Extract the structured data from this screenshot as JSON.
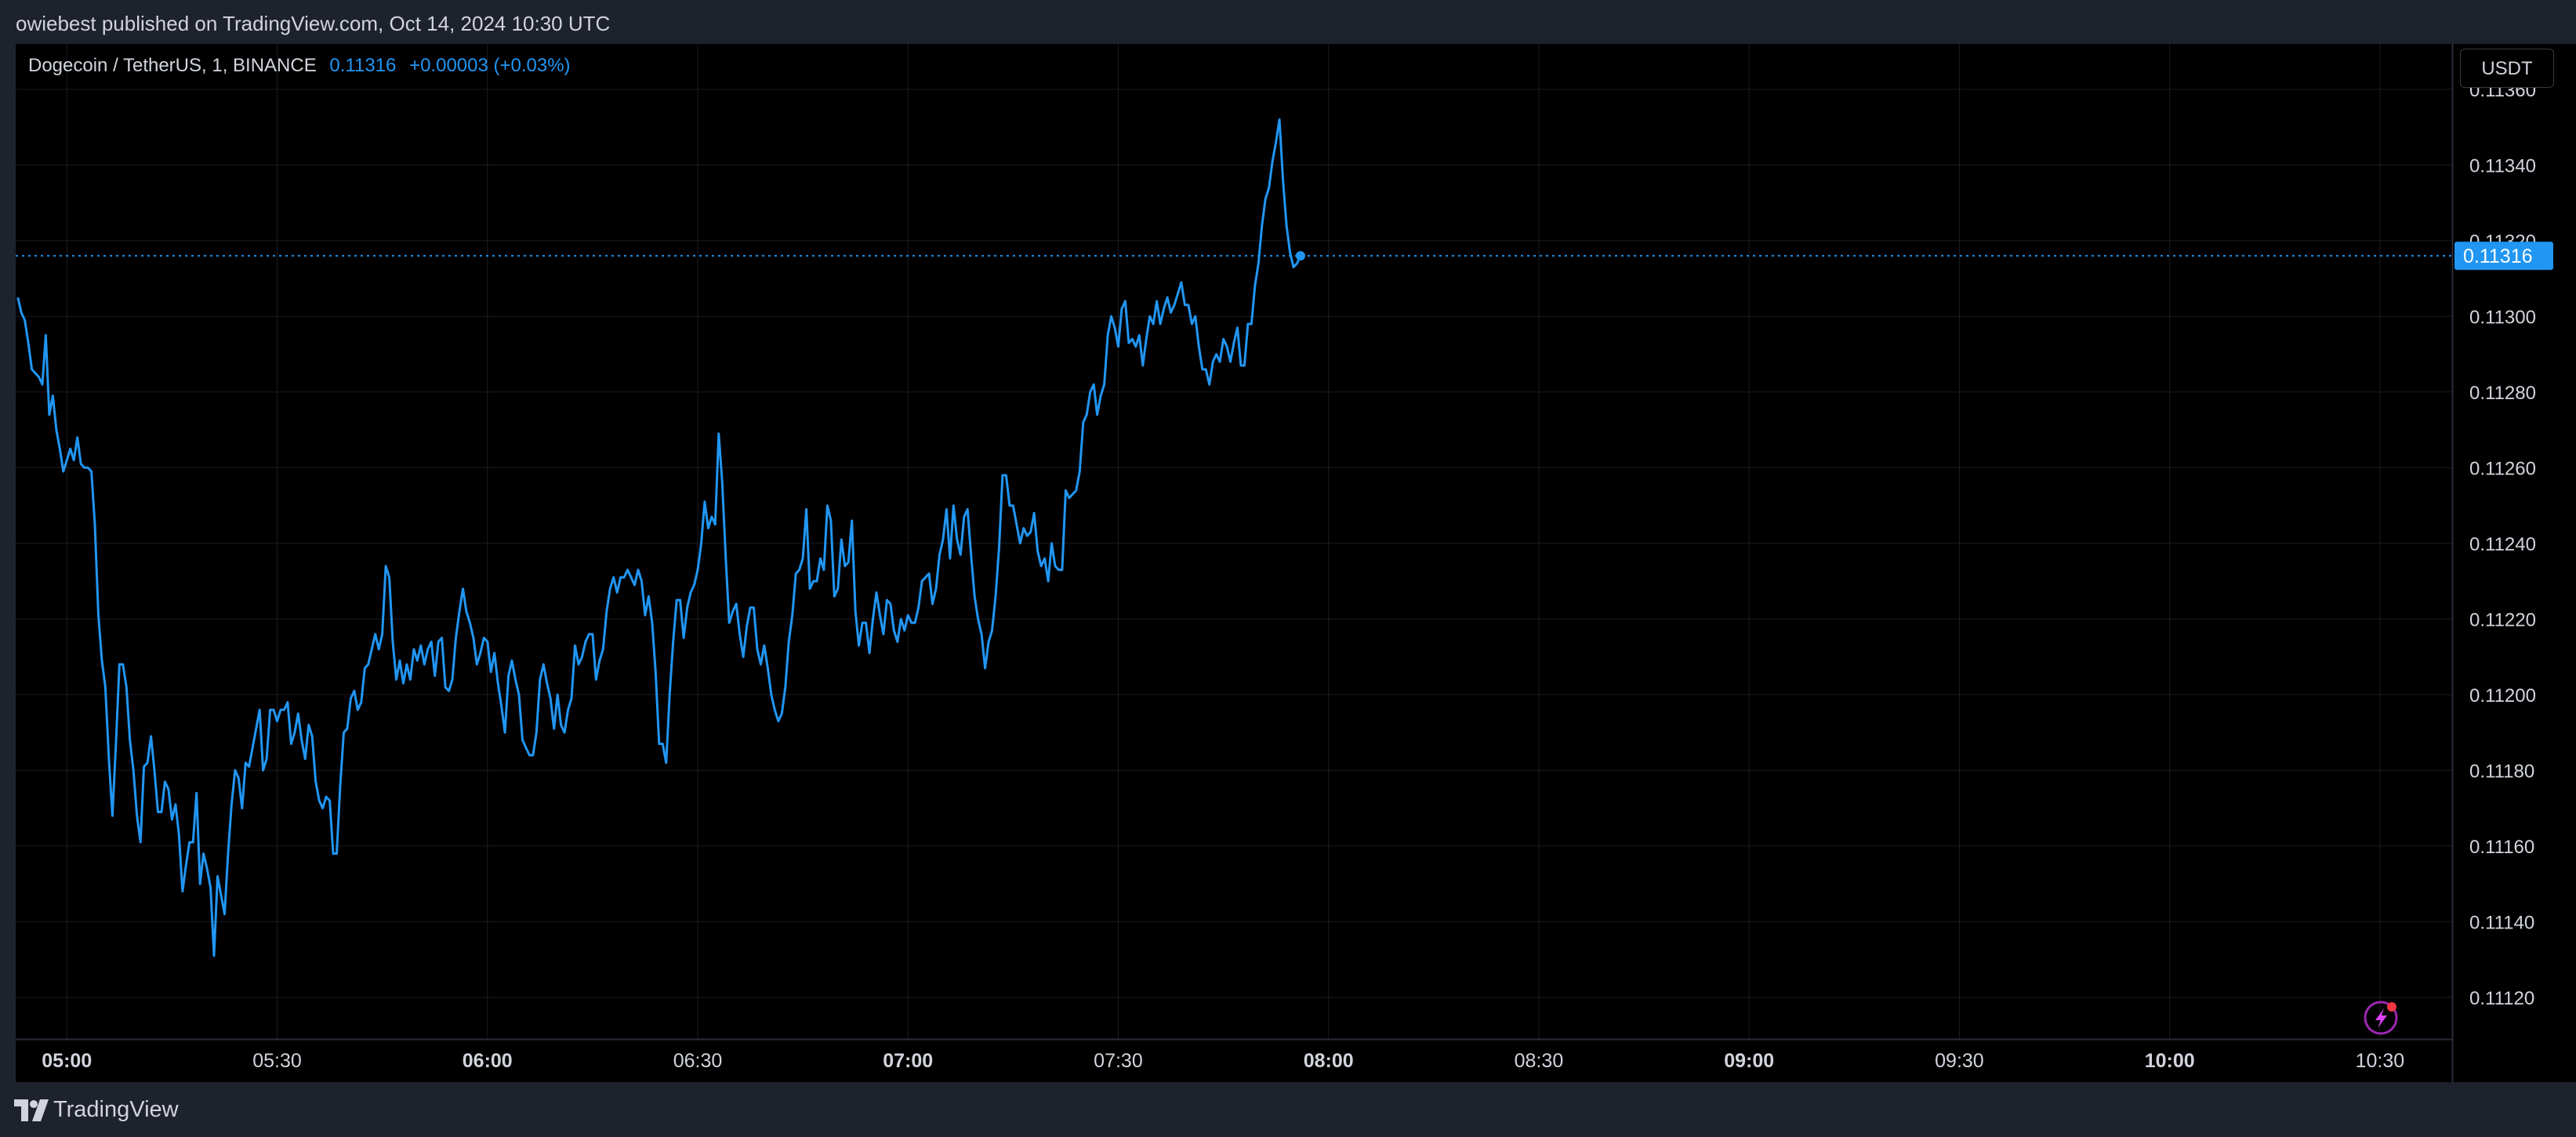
{
  "publisher_line": "owiebest published on TradingView.com, Oct 14, 2024 10:30 UTC",
  "legend": {
    "symbol": "Dogecoin / TetherUS, 1, BINANCE",
    "last": "0.11316",
    "change": "+0.00003 (+0.03%)"
  },
  "currency_label": "USDT",
  "last_price_label": "0.11316",
  "footer": {
    "brand": "TradingView"
  },
  "colors": {
    "line": "#2196f3",
    "background": "#000000",
    "frame": "#1e222d",
    "grid": "#1a1c22",
    "text": "#d1d4dc"
  },
  "chart_data": {
    "type": "line",
    "title": "Dogecoin / TetherUS, 1, BINANCE",
    "xlabel": "",
    "ylabel": "",
    "ylim": [
      0.11109,
      0.11372
    ],
    "grid": true,
    "y_ticks": [
      "0.11120",
      "0.11140",
      "0.11160",
      "0.11180",
      "0.11200",
      "0.11220",
      "0.11240",
      "0.11260",
      "0.11280",
      "0.11300",
      "0.11320",
      "0.11340",
      "0.11360"
    ],
    "x_ticks": [
      {
        "label": "05:00",
        "minute": 300,
        "bold": true
      },
      {
        "label": "05:30",
        "minute": 330,
        "bold": false
      },
      {
        "label": "06:00",
        "minute": 360,
        "bold": true
      },
      {
        "label": "06:30",
        "minute": 390,
        "bold": false
      },
      {
        "label": "07:00",
        "minute": 420,
        "bold": true
      },
      {
        "label": "07:30",
        "minute": 450,
        "bold": false
      },
      {
        "label": "08:00",
        "minute": 480,
        "bold": true
      },
      {
        "label": "08:30",
        "minute": 510,
        "bold": false
      },
      {
        "label": "09:00",
        "minute": 540,
        "bold": true
      },
      {
        "label": "09:30",
        "minute": 570,
        "bold": false
      },
      {
        "label": "10:00",
        "minute": 600,
        "bold": true
      },
      {
        "label": "10:30",
        "minute": 630,
        "bold": false
      }
    ],
    "xlim_minutes": [
      292.7,
      640.3
    ],
    "last_value": 0.11316,
    "series": [
      {
        "x_start_minute": 293,
        "x_step_minutes": 0.5,
        "values": [
          0.11305,
          0.11301,
          0.11299,
          0.11293,
          0.11286,
          0.11285,
          0.11284,
          0.11282,
          0.11295,
          0.11274,
          0.11279,
          0.1127,
          0.11265,
          0.11259,
          0.11262,
          0.11265,
          0.11262,
          0.11268,
          0.11261,
          0.1126,
          0.1126,
          0.11259,
          0.11245,
          0.11221,
          0.11209,
          0.11202,
          0.11183,
          0.11168,
          0.11187,
          0.11208,
          0.11208,
          0.11202,
          0.11188,
          0.1118,
          0.11168,
          0.11161,
          0.11181,
          0.11182,
          0.11189,
          0.1118,
          0.11169,
          0.11169,
          0.11177,
          0.11175,
          0.11167,
          0.11171,
          0.11163,
          0.11148,
          0.11155,
          0.11161,
          0.11161,
          0.11174,
          0.1115,
          0.11158,
          0.11154,
          0.11149,
          0.11131,
          0.11152,
          0.11147,
          0.11142,
          0.11158,
          0.11171,
          0.1118,
          0.11178,
          0.1117,
          0.11182,
          0.11181,
          0.11186,
          0.11191,
          0.11196,
          0.1118,
          0.11183,
          0.11196,
          0.11196,
          0.11193,
          0.11196,
          0.11196,
          0.11198,
          0.11187,
          0.1119,
          0.11195,
          0.11188,
          0.11183,
          0.11192,
          0.11189,
          0.11177,
          0.11172,
          0.1117,
          0.11173,
          0.11172,
          0.11158,
          0.11158,
          0.11176,
          0.1119,
          0.11191,
          0.11199,
          0.11201,
          0.11196,
          0.11198,
          0.11207,
          0.11208,
          0.11212,
          0.11216,
          0.11212,
          0.11216,
          0.11234,
          0.11231,
          0.11214,
          0.11204,
          0.11209,
          0.11203,
          0.11208,
          0.11204,
          0.11212,
          0.11209,
          0.11213,
          0.11208,
          0.11212,
          0.11214,
          0.11205,
          0.11214,
          0.11215,
          0.11202,
          0.11201,
          0.11204,
          0.11215,
          0.11222,
          0.11228,
          0.11222,
          0.11219,
          0.11215,
          0.11208,
          0.11211,
          0.11215,
          0.11214,
          0.11206,
          0.11211,
          0.11203,
          0.11197,
          0.1119,
          0.11205,
          0.11209,
          0.11204,
          0.112,
          0.11188,
          0.11186,
          0.11184,
          0.11184,
          0.1119,
          0.11204,
          0.11208,
          0.11203,
          0.11199,
          0.11191,
          0.112,
          0.11192,
          0.1119,
          0.11196,
          0.11199,
          0.11213,
          0.11208,
          0.1121,
          0.11214,
          0.11216,
          0.11216,
          0.11204,
          0.11209,
          0.11212,
          0.11222,
          0.11228,
          0.11231,
          0.11227,
          0.11231,
          0.11231,
          0.11233,
          0.11231,
          0.11229,
          0.11233,
          0.1123,
          0.11221,
          0.11226,
          0.11219,
          0.11206,
          0.11187,
          0.11187,
          0.11182,
          0.112,
          0.11214,
          0.11225,
          0.11225,
          0.11215,
          0.11223,
          0.11227,
          0.11229,
          0.11233,
          0.1124,
          0.11251,
          0.11244,
          0.11247,
          0.11245,
          0.11269,
          0.11256,
          0.11236,
          0.11219,
          0.11222,
          0.11224,
          0.11216,
          0.1121,
          0.11218,
          0.11223,
          0.11223,
          0.11212,
          0.11208,
          0.11213,
          0.11207,
          0.112,
          0.11196,
          0.11193,
          0.11195,
          0.11202,
          0.11214,
          0.11221,
          0.11232,
          0.11233,
          0.11236,
          0.11249,
          0.11228,
          0.1123,
          0.1123,
          0.11236,
          0.11233,
          0.1125,
          0.11246,
          0.11226,
          0.11228,
          0.11241,
          0.11234,
          0.11235,
          0.11246,
          0.11222,
          0.11213,
          0.11219,
          0.11219,
          0.11211,
          0.1122,
          0.11227,
          0.11221,
          0.11216,
          0.11225,
          0.11224,
          0.11217,
          0.11214,
          0.1122,
          0.11217,
          0.11221,
          0.11219,
          0.11219,
          0.11223,
          0.1123,
          0.11231,
          0.11232,
          0.11224,
          0.11228,
          0.11237,
          0.11241,
          0.11249,
          0.11236,
          0.1125,
          0.11241,
          0.11237,
          0.11247,
          0.11249,
          0.11237,
          0.11226,
          0.1122,
          0.11216,
          0.11207,
          0.11214,
          0.11217,
          0.11226,
          0.11239,
          0.11258,
          0.11258,
          0.1125,
          0.1125,
          0.11245,
          0.1124,
          0.11244,
          0.11242,
          0.11243,
          0.11248,
          0.11238,
          0.11234,
          0.11236,
          0.1123,
          0.1124,
          0.11234,
          0.11233,
          0.11233,
          0.11254,
          0.11252,
          0.11253,
          0.11254,
          0.11259,
          0.11272,
          0.11274,
          0.1128,
          0.11282,
          0.11274,
          0.11279,
          0.11282,
          0.11295,
          0.113,
          0.11297,
          0.11292,
          0.11302,
          0.11304,
          0.11293,
          0.11294,
          0.11292,
          0.11295,
          0.11287,
          0.11294,
          0.113,
          0.11298,
          0.11304,
          0.11298,
          0.11302,
          0.11305,
          0.11301,
          0.11303,
          0.11306,
          0.11309,
          0.11303,
          0.11303,
          0.11298,
          0.113,
          0.11292,
          0.11286,
          0.11286,
          0.11282,
          0.11288,
          0.1129,
          0.11288,
          0.11294,
          0.11292,
          0.11288,
          0.11293,
          0.11297,
          0.11287,
          0.11287,
          0.11298,
          0.11298,
          0.11308,
          0.11314,
          0.11324,
          0.11331,
          0.11334,
          0.11341,
          0.11346,
          0.11352,
          0.11336,
          0.11324,
          0.11317,
          0.11313,
          0.11314,
          0.11316
        ]
      }
    ]
  }
}
